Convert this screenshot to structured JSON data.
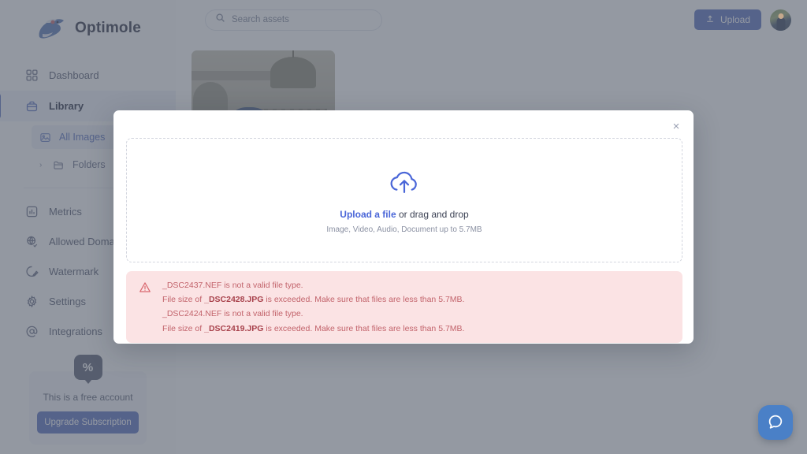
{
  "brand": {
    "name": "Optimole",
    "logo_icon": "optimole-mole-logo"
  },
  "sidebar": {
    "items": [
      {
        "label": "Dashboard",
        "icon": "grid-icon"
      },
      {
        "label": "Library",
        "icon": "briefcase-icon"
      }
    ],
    "sub_items": [
      {
        "label": "All Images",
        "icon": "image-icon"
      },
      {
        "label": "Folders",
        "icon": "folder-icon"
      }
    ],
    "items2": [
      {
        "label": "Metrics",
        "icon": "chart-bar-icon"
      },
      {
        "label": "Allowed Domains",
        "icon": "globe-check-icon"
      },
      {
        "label": "Watermark",
        "icon": "watermark-pencil-icon"
      },
      {
        "label": "Settings",
        "icon": "gear-icon"
      },
      {
        "label": "Integrations",
        "icon": "at-sign-icon"
      }
    ],
    "free_card": {
      "badge": "%",
      "text": "This is a free account",
      "button": "Upgrade Subscription"
    }
  },
  "topbar": {
    "search_placeholder": "Search assets",
    "search_value": "",
    "search_icon": "search-icon",
    "upload_label": "Upload",
    "upload_icon": "upload-icon",
    "avatar_icon": "user-avatar"
  },
  "modal": {
    "close_label": "×",
    "dropzone": {
      "icon": "cloud-upload-icon",
      "link": "Upload a file",
      "rest": " or drag and drop",
      "hint": "Image, Video, Audio, Document up to 5.7MB"
    },
    "errors": {
      "icon": "warning-triangle-icon",
      "lines": [
        {
          "pre": "_DSC2437.NEF",
          "bold": "",
          "post": " is not a valid file type.",
          "bold_first": false
        },
        {
          "pre": "File size of ",
          "bold": "_DSC2428.JPG",
          "post": " is exceeded. Make sure that files are less than 5.7MB.",
          "bold_first": false
        },
        {
          "pre": "_DSC2424.NEF",
          "bold": "",
          "post": " is not a valid file type.",
          "bold_first": false
        },
        {
          "pre": "File size of ",
          "bold": "_DSC2419.JPG",
          "post": " is exceeded. Make sure that files are less than 5.7MB.",
          "bold_first": false
        }
      ]
    }
  },
  "beacon": {
    "icon": "chat-bubble-icon"
  },
  "colors": {
    "accent_blue": "#5b72c0",
    "link_blue": "#4a66d8",
    "error_bg": "#fbe3e4",
    "error_text": "#c2636b",
    "beacon_blue": "#4a80c7",
    "overlay": "rgba(83,90,105,.62)"
  }
}
